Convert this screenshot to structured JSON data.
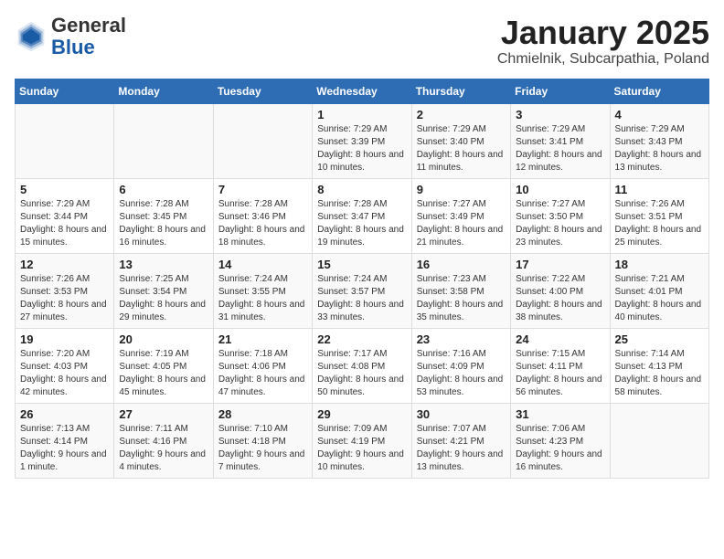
{
  "header": {
    "logo_general": "General",
    "logo_blue": "Blue",
    "title": "January 2025",
    "location": "Chmielnik, Subcarpathia, Poland"
  },
  "days_of_week": [
    "Sunday",
    "Monday",
    "Tuesday",
    "Wednesday",
    "Thursday",
    "Friday",
    "Saturday"
  ],
  "weeks": [
    [
      {
        "day": "",
        "info": ""
      },
      {
        "day": "",
        "info": ""
      },
      {
        "day": "",
        "info": ""
      },
      {
        "day": "1",
        "info": "Sunrise: 7:29 AM\nSunset: 3:39 PM\nDaylight: 8 hours\nand 10 minutes."
      },
      {
        "day": "2",
        "info": "Sunrise: 7:29 AM\nSunset: 3:40 PM\nDaylight: 8 hours\nand 11 minutes."
      },
      {
        "day": "3",
        "info": "Sunrise: 7:29 AM\nSunset: 3:41 PM\nDaylight: 8 hours\nand 12 minutes."
      },
      {
        "day": "4",
        "info": "Sunrise: 7:29 AM\nSunset: 3:43 PM\nDaylight: 8 hours\nand 13 minutes."
      }
    ],
    [
      {
        "day": "5",
        "info": "Sunrise: 7:29 AM\nSunset: 3:44 PM\nDaylight: 8 hours\nand 15 minutes."
      },
      {
        "day": "6",
        "info": "Sunrise: 7:28 AM\nSunset: 3:45 PM\nDaylight: 8 hours\nand 16 minutes."
      },
      {
        "day": "7",
        "info": "Sunrise: 7:28 AM\nSunset: 3:46 PM\nDaylight: 8 hours\nand 18 minutes."
      },
      {
        "day": "8",
        "info": "Sunrise: 7:28 AM\nSunset: 3:47 PM\nDaylight: 8 hours\nand 19 minutes."
      },
      {
        "day": "9",
        "info": "Sunrise: 7:27 AM\nSunset: 3:49 PM\nDaylight: 8 hours\nand 21 minutes."
      },
      {
        "day": "10",
        "info": "Sunrise: 7:27 AM\nSunset: 3:50 PM\nDaylight: 8 hours\nand 23 minutes."
      },
      {
        "day": "11",
        "info": "Sunrise: 7:26 AM\nSunset: 3:51 PM\nDaylight: 8 hours\nand 25 minutes."
      }
    ],
    [
      {
        "day": "12",
        "info": "Sunrise: 7:26 AM\nSunset: 3:53 PM\nDaylight: 8 hours\nand 27 minutes."
      },
      {
        "day": "13",
        "info": "Sunrise: 7:25 AM\nSunset: 3:54 PM\nDaylight: 8 hours\nand 29 minutes."
      },
      {
        "day": "14",
        "info": "Sunrise: 7:24 AM\nSunset: 3:55 PM\nDaylight: 8 hours\nand 31 minutes."
      },
      {
        "day": "15",
        "info": "Sunrise: 7:24 AM\nSunset: 3:57 PM\nDaylight: 8 hours\nand 33 minutes."
      },
      {
        "day": "16",
        "info": "Sunrise: 7:23 AM\nSunset: 3:58 PM\nDaylight: 8 hours\nand 35 minutes."
      },
      {
        "day": "17",
        "info": "Sunrise: 7:22 AM\nSunset: 4:00 PM\nDaylight: 8 hours\nand 38 minutes."
      },
      {
        "day": "18",
        "info": "Sunrise: 7:21 AM\nSunset: 4:01 PM\nDaylight: 8 hours\nand 40 minutes."
      }
    ],
    [
      {
        "day": "19",
        "info": "Sunrise: 7:20 AM\nSunset: 4:03 PM\nDaylight: 8 hours\nand 42 minutes."
      },
      {
        "day": "20",
        "info": "Sunrise: 7:19 AM\nSunset: 4:05 PM\nDaylight: 8 hours\nand 45 minutes."
      },
      {
        "day": "21",
        "info": "Sunrise: 7:18 AM\nSunset: 4:06 PM\nDaylight: 8 hours\nand 47 minutes."
      },
      {
        "day": "22",
        "info": "Sunrise: 7:17 AM\nSunset: 4:08 PM\nDaylight: 8 hours\nand 50 minutes."
      },
      {
        "day": "23",
        "info": "Sunrise: 7:16 AM\nSunset: 4:09 PM\nDaylight: 8 hours\nand 53 minutes."
      },
      {
        "day": "24",
        "info": "Sunrise: 7:15 AM\nSunset: 4:11 PM\nDaylight: 8 hours\nand 56 minutes."
      },
      {
        "day": "25",
        "info": "Sunrise: 7:14 AM\nSunset: 4:13 PM\nDaylight: 8 hours\nand 58 minutes."
      }
    ],
    [
      {
        "day": "26",
        "info": "Sunrise: 7:13 AM\nSunset: 4:14 PM\nDaylight: 9 hours\nand 1 minute."
      },
      {
        "day": "27",
        "info": "Sunrise: 7:11 AM\nSunset: 4:16 PM\nDaylight: 9 hours\nand 4 minutes."
      },
      {
        "day": "28",
        "info": "Sunrise: 7:10 AM\nSunset: 4:18 PM\nDaylight: 9 hours\nand 7 minutes."
      },
      {
        "day": "29",
        "info": "Sunrise: 7:09 AM\nSunset: 4:19 PM\nDaylight: 9 hours\nand 10 minutes."
      },
      {
        "day": "30",
        "info": "Sunrise: 7:07 AM\nSunset: 4:21 PM\nDaylight: 9 hours\nand 13 minutes."
      },
      {
        "day": "31",
        "info": "Sunrise: 7:06 AM\nSunset: 4:23 PM\nDaylight: 9 hours\nand 16 minutes."
      },
      {
        "day": "",
        "info": ""
      }
    ]
  ]
}
